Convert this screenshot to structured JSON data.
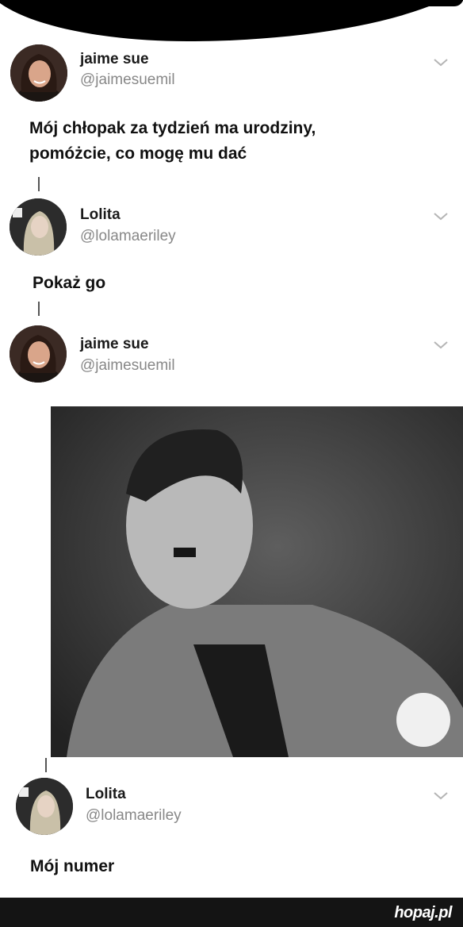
{
  "tweets": [
    {
      "name": "jaime sue",
      "handle": "@jaimesuemil",
      "text_lines": [
        "Mój chłopak za tydzień ma urodziny,",
        "pomóżcie, co mogę mu dać"
      ]
    },
    {
      "name": "Lolita",
      "handle": "@lolamaeriley",
      "text": "Pokaż go"
    },
    {
      "name": "jaime sue",
      "handle": "@jaimesuemil"
    },
    {
      "name": "Lolita",
      "handle": "@lolamaeriley",
      "text": "Mój numer"
    }
  ],
  "photo": {
    "description_icon": "portrait-photo"
  },
  "footer": {
    "brand": "hopaj.pl"
  },
  "colors": {
    "name": "#1a1a1a",
    "handle": "#888888",
    "footer_bg": "#141414"
  }
}
